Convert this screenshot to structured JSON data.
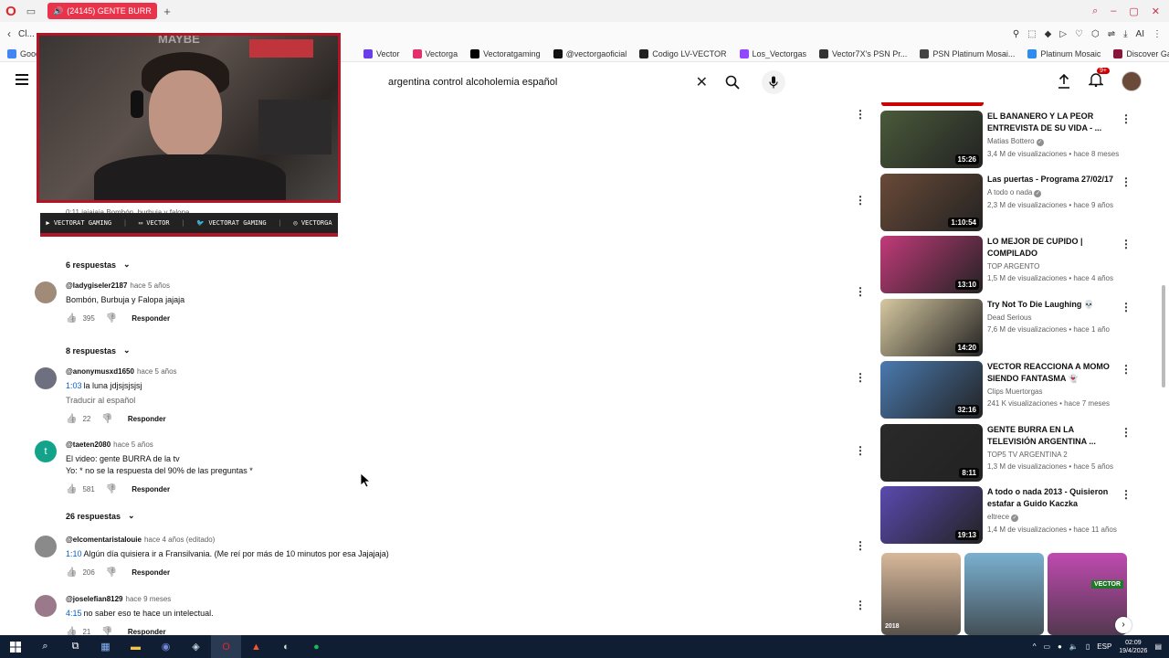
{
  "browser": {
    "tab_title": "(24145) GENTE BURR",
    "url_preview": "Cl...",
    "bookmarks": [
      {
        "label": "Goog",
        "color": "#4285f4"
      },
      {
        "label": "Vector",
        "color": "#6a3de8"
      },
      {
        "label": "Vectorga",
        "color": "#e1306c"
      },
      {
        "label": "Vectoratgaming",
        "color": "#000000"
      },
      {
        "label": "@vectorgaoficial",
        "color": "#111111"
      },
      {
        "label": "Codigo LV-VECTOR",
        "color": "#222222"
      },
      {
        "label": "Los_Vectorgas",
        "color": "#9146ff"
      },
      {
        "label": "Vector7X's PSN Pr...",
        "color": "#333333"
      },
      {
        "label": "PSN Platinum Mosai...",
        "color": "#444444"
      },
      {
        "label": "Platinum Mosaic",
        "color": "#2d8cf0"
      },
      {
        "label": "Discover Games -...",
        "color": "#8a1538"
      }
    ]
  },
  "header": {
    "search_query": "argentina control alcoholemia español",
    "notifications_badge": "9+"
  },
  "overlay": {
    "watermark": "MAYBE",
    "partial_comment": "0:11  jajajaja Bombón, burbuja y falopa",
    "social": [
      {
        "label": "VECTORAT GAMING"
      },
      {
        "label": "VECTOR"
      },
      {
        "label": "VECTORAT GAMING"
      },
      {
        "label": "VECTORGA"
      }
    ]
  },
  "comments": {
    "reply_label": "Responder",
    "items": [
      {
        "type": "replies",
        "label": "6 respuestas"
      },
      {
        "type": "comment",
        "handle": "@ladygiseler2187",
        "time": "hace 5 años",
        "timestamp": "",
        "text": "Bombón, Burbuja y Falopa jajaja",
        "translate": "",
        "likes": "395",
        "avatar": "#a08a78"
      },
      {
        "type": "replies",
        "label": "8 respuestas"
      },
      {
        "type": "comment",
        "handle": "@anonymusxd1650",
        "time": "hace 5 años",
        "timestamp": "1:03",
        "text": "la luna jdjsjsjsjsj",
        "translate": "Traducir al español",
        "likes": "22",
        "avatar": "#6e7080"
      },
      {
        "type": "comment",
        "handle": "@taeten2080",
        "time": "hace 5 años",
        "timestamp": "",
        "text": "El video: gente BURRA de la tv",
        "text2": "Yo: * no se la respuesta del 90% de las preguntas *",
        "translate": "",
        "likes": "581",
        "avatar": "#12a38a",
        "initial": "t"
      },
      {
        "type": "replies",
        "label": "26 respuestas"
      },
      {
        "type": "comment",
        "handle": "@elcomentaristalouie",
        "time": "hace 4 años (editado)",
        "timestamp": "1:10",
        "text": "Algún día quisiera ir a Fransilvania. (Me reí por más de 10 minutos por esa Jajajaja)",
        "translate": "",
        "likes": "206",
        "avatar": "#8a8a8a"
      },
      {
        "type": "comment",
        "handle": "@joselefian8129",
        "time": "hace 9 meses",
        "timestamp": "4:15",
        "text": "no saber eso te hace un intelectual.",
        "translate": "",
        "likes": "21",
        "avatar": "#9a7a8a"
      }
    ]
  },
  "sidebar": {
    "videos": [
      {
        "title": "EL BANANERO Y LA PEOR ENTREVISTA DE SU VIDA - ...",
        "channel": "Matias Bottero",
        "verified": true,
        "stats": "3,4 M de visualizaciones • hace 8 meses",
        "duration": "15:26",
        "thumb": "#4a5a3a"
      },
      {
        "title": "Las puertas - Programa 27/02/17",
        "channel": "A todo o nada",
        "verified": true,
        "stats": "2,3 M de visualizaciones • hace 9 años",
        "duration": "1:10:54",
        "thumb": "#6a4a38"
      },
      {
        "title": "LO MEJOR DE CUPIDO | COMPILADO",
        "channel": "TOP ARGENTO",
        "verified": false,
        "stats": "1,5 M de visualizaciones • hace 4 años",
        "duration": "13:10",
        "thumb": "#c23a7a"
      },
      {
        "title": "Try Not To Die Laughing 💀",
        "channel": "Dead Serious",
        "verified": false,
        "stats": "7,6 M de visualizaciones • hace 1 año",
        "duration": "14:20",
        "thumb": "#d6c8a0"
      },
      {
        "title": "VECTOR REACCIONA A MOMO SIENDO FANTASMA 👻",
        "channel": "Clips Muertorgas",
        "verified": false,
        "stats": "241 K visualizaciones • hace 7 meses",
        "duration": "32:16",
        "thumb": "#4a7ab0"
      },
      {
        "title": "GENTE BURRA EN LA TELEVISIÓN ARGENTINA ...",
        "channel": "TOP5 TV ARGENTINA 2",
        "verified": false,
        "stats": "1,3 M de visualizaciones • hace 5 años",
        "duration": "8:11",
        "thumb": "#2a2a2a"
      },
      {
        "title": "A todo o nada 2013 - Quisieron estafar a Guido Kaczka",
        "channel": "eltrece",
        "verified": true,
        "stats": "1,4 M de visualizaciones • hace 11 años",
        "duration": "19:13",
        "thumb": "#5a4ab0"
      }
    ],
    "shorts": [
      {
        "label": "2018",
        "color": "#d8b89a"
      },
      {
        "label": "",
        "color": "#7ab0d0"
      },
      {
        "label": "",
        "color": "#c04ab0",
        "badge": "VECTOR"
      }
    ]
  },
  "taskbar": {
    "lang": "ESP",
    "time": "02:09",
    "date": "19/4/2026"
  }
}
